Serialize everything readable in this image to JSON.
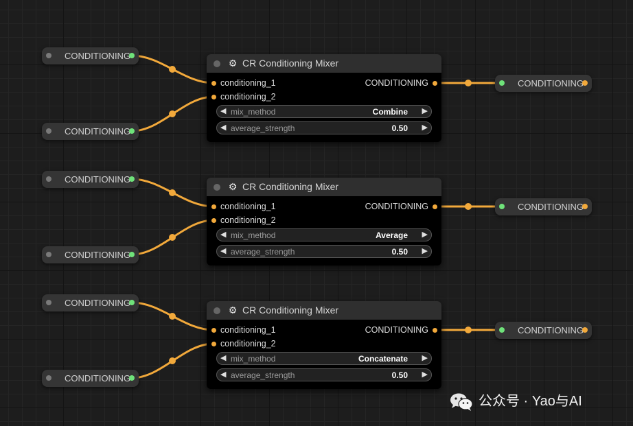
{
  "sources": [
    {
      "label": "CONDITIONING"
    },
    {
      "label": "CONDITIONING"
    },
    {
      "label": "CONDITIONING"
    },
    {
      "label": "CONDITIONING"
    },
    {
      "label": "CONDITIONING"
    },
    {
      "label": "CONDITIONING"
    }
  ],
  "mixers": [
    {
      "title": "CR Conditioning Mixer",
      "input_1": "conditioning_1",
      "input_2": "conditioning_2",
      "output": "CONDITIONING",
      "mix_method_label": "mix_method",
      "mix_method_value": "Combine",
      "average_strength_label": "average_strength",
      "average_strength_value": "0.50"
    },
    {
      "title": "CR Conditioning Mixer",
      "input_1": "conditioning_1",
      "input_2": "conditioning_2",
      "output": "CONDITIONING",
      "mix_method_label": "mix_method",
      "mix_method_value": "Average",
      "average_strength_label": "average_strength",
      "average_strength_value": "0.50"
    },
    {
      "title": "CR Conditioning Mixer",
      "input_1": "conditioning_1",
      "input_2": "conditioning_2",
      "output": "CONDITIONING",
      "mix_method_label": "mix_method",
      "mix_method_value": "Concatenate",
      "average_strength_label": "average_strength",
      "average_strength_value": "0.50"
    }
  ],
  "outputs": [
    {
      "label": "CONDITIONING"
    },
    {
      "label": "CONDITIONING"
    },
    {
      "label": "CONDITIONING"
    }
  ],
  "icons": {
    "mixer_header": "gear-icon",
    "widget_left": "arrow-left-icon",
    "widget_right": "arrow-right-icon",
    "watermark": "wechat-icon"
  },
  "watermark": {
    "text": "公众号 · Yao与AI"
  },
  "colors": {
    "wire": "#f2a93b",
    "output_slot_dot": "#6fe27a",
    "input_slot_dot": "#f2a93b",
    "inactive_dot": "#7a7a7a",
    "node_bg": "#353535",
    "canvas_bg": "#1d1d1d"
  }
}
